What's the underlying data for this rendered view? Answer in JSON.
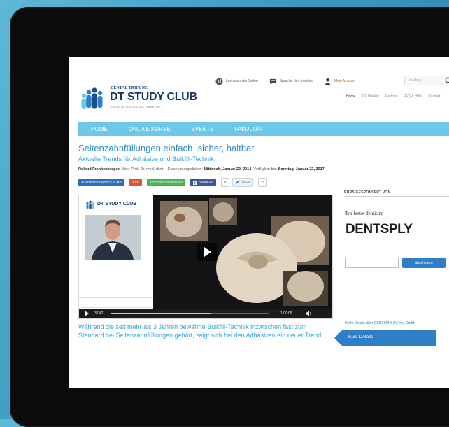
{
  "header": {
    "logo_tribune": "DENTAL TRIBUNE",
    "logo_title": "DT STUDY CLUB",
    "logo_sub": "KURSE | FOREN | BLOGS | KENNTNIS",
    "top_links": [
      {
        "label": "Internationale Seiten",
        "icon": "globe-icon"
      },
      {
        "label": "Sprache des Inhaltes",
        "icon": "speech-bubble-icon"
      },
      {
        "label": "Mein Account",
        "icon": "user-icon"
      }
    ],
    "search_placeholder": "Suchen",
    "sub_nav": [
      "Home",
      "CE Punkte",
      "Partner",
      "FAQ & Hilfe",
      "Kontakt"
    ]
  },
  "main_nav": [
    "HOME",
    "ONLINE KURSE",
    "EVENTS",
    "FAKULTÄT"
  ],
  "course": {
    "title": "Seitenzahnfüllungen einfach, sicher, haltbar.",
    "subtitle": "Aktuelle Trends für Adhäsive und Bulkfill-Technik.",
    "meta_author": "Roland Frankenberger,",
    "meta_degree": " Univ.-Prof. Dr. med. dent. , Erscheinungsdatum: ",
    "meta_date": "Mittwoch, Januar 22, 2014",
    "meta_avail": ", Verfügbar bis: ",
    "meta_until": "Sonntag, Januar 22, 2017",
    "tags": [
      "AUFGEZEICHNETES KURS",
      "1 CE",
      "KOSTENLOSER KURS"
    ],
    "facebook_label": "Gefällt mir",
    "facebook_count": "0",
    "tweet_label": "Tweet",
    "tweet_count": "0",
    "description": "Während die seit mehr als 3 Jahren bewährte Bulkfill-Technik inzwischen fast zum Standard bei Seitenzahnfüllungen gehört, zeigt sich bei den Adhäsiven ein neuer Trend."
  },
  "video": {
    "panel_logo": "DT STUDY CLUB",
    "elapsed": "37:47",
    "duration": "1:00:08",
    "progress": 0.63
  },
  "sidebar": {
    "sponsor_heading": "KURS GESPONSERT VON",
    "sponsor_tagline": "For better dentistry",
    "sponsor_name": "DENTSPLY",
    "submit_label": "abschicken",
    "details_link": "Mehr Details über DENTSPLY DeTrey GmbH",
    "kurs_details": "Kurs-Details"
  },
  "colors": {
    "nav_bg": "#6cc7e8",
    "title_blue": "#2f8dc8",
    "button_blue": "#2f7fc6",
    "tag_red": "#d9563b",
    "tag_green": "#4bb35a"
  }
}
